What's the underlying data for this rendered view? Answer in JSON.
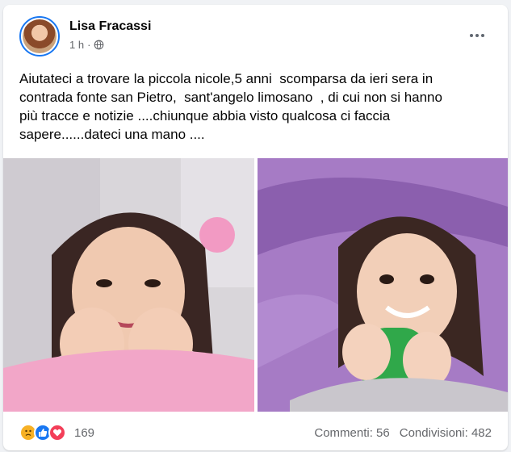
{
  "post": {
    "author": "Lisa Fracassi",
    "time": "1 h",
    "separator": "·",
    "privacy_icon": "globe-icon",
    "more_icon": "more-options-icon",
    "text": "Aiutateci a trovare la piccola nicole,5 anni  scomparsa da ieri sera in\ncontrada fonte san Pietro,  sant'angelo limosano  , di cui non si hanno\npiù tracce e notizie ....chiunque abbia visto qualcosa ci faccia\nsapere......dateci una mano ....",
    "photos": [
      {
        "description_icon": "child-photo-pink-shirt"
      },
      {
        "description_icon": "child-photo-purple-blanket"
      }
    ]
  },
  "footer": {
    "reaction_icons": [
      "sad-reaction-icon",
      "like-reaction-icon",
      "love-reaction-icon"
    ],
    "reaction_count": "169",
    "comments": "Commenti: 56",
    "shares": "Condivisioni: 482"
  },
  "colors": {
    "accent": "#1877f2",
    "secondary_text": "#65676b",
    "background": "#f0f2f5"
  }
}
